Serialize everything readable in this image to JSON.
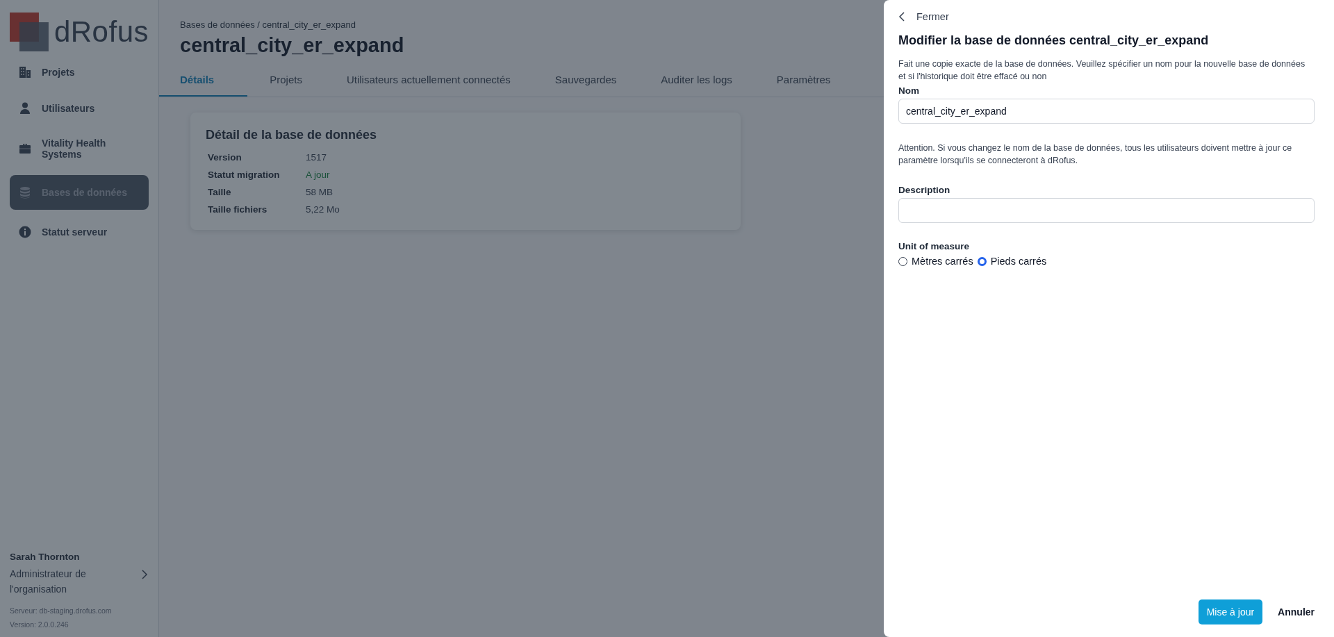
{
  "sidebar": {
    "logo_text": "dRofus",
    "items": [
      {
        "label": "Projets",
        "selected": false
      },
      {
        "label": "Utilisateurs",
        "selected": false
      },
      {
        "label": "Vitality Health Systems",
        "selected": false
      },
      {
        "label": "Bases de données",
        "selected": true
      },
      {
        "label": "Statut serveur",
        "selected": false
      }
    ],
    "user": {
      "name": "Sarah Thornton",
      "role": "Administrateur de l'organisation"
    },
    "server": "Serveur: db-staging.drofus.com",
    "version": "Version: 2.0.0.246"
  },
  "breadcrumb": "Bases de données / central_city_er_expand",
  "title": "central_city_er_expand",
  "tabs": [
    {
      "label": "Détails",
      "selected": true
    },
    {
      "label": "Projets",
      "selected": false
    },
    {
      "label": "Utilisateurs actuellement connectés",
      "selected": false
    },
    {
      "label": "Sauvegardes",
      "selected": false
    },
    {
      "label": "Auditer les logs",
      "selected": false
    },
    {
      "label": "Paramètres",
      "selected": false
    }
  ],
  "details_card": {
    "title": "Détail de la base de données",
    "rows": [
      {
        "label": "Version",
        "value": "1517",
        "kind": "plain"
      },
      {
        "label": "Statut migration",
        "value": "A jour",
        "kind": "status"
      },
      {
        "label": "Taille",
        "value": "58 MB",
        "kind": "plain"
      },
      {
        "label": "Taille fichiers",
        "value": "5,22 Mo",
        "kind": "plain"
      }
    ]
  },
  "panel": {
    "close_label": "Fermer",
    "heading": "Modifier la base de données central_city_er_expand",
    "intro": "Fait une copie exacte de la base de données. Veuillez spécifier un nom pour la nouvelle base de données et si l'historique doit être effacé ou non",
    "name_label": "Nom",
    "name_value": "central_city_er_expand",
    "warning": "Attention. Si vous changez le nom de la base de données, tous les utilisateurs doivent mettre à jour ce paramètre lorsqu'ils se connecteront à dRofus.",
    "description_label": "Description",
    "unit_label": "Unit of measure",
    "units": [
      {
        "label": "Mètres carrés",
        "selected": false
      },
      {
        "label": "Pieds carrés",
        "selected": true
      }
    ],
    "buttons": [
      {
        "label": "Mise à jour",
        "kind": "primary"
      },
      {
        "label": "Annuler",
        "kind": "link"
      }
    ]
  }
}
